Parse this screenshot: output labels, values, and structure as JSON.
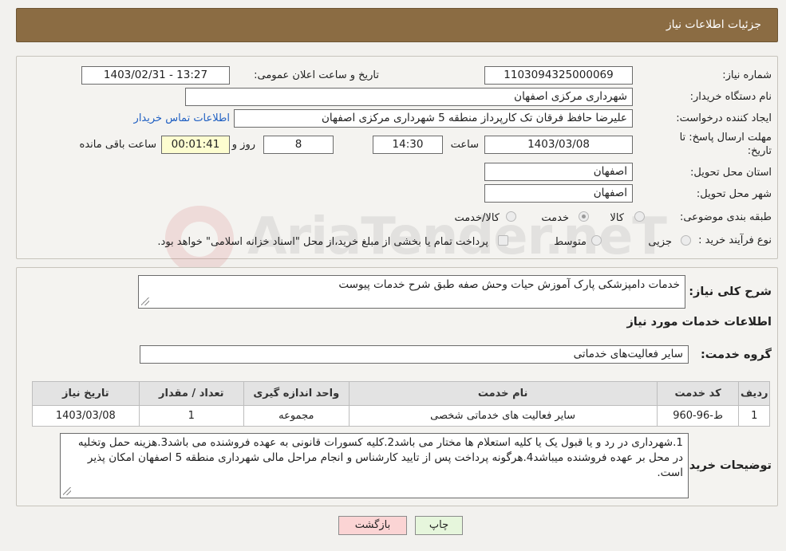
{
  "header": {
    "title": "جزئیات اطلاعات نیاز"
  },
  "details": {
    "need_number_label": "شماره نیاز:",
    "need_number": "1103094325000069",
    "announce_label": "تاریخ و ساعت اعلان عمومی:",
    "announce_value": "1403/02/31 - 13:27",
    "buyer_org_label": "نام دستگاه خریدار:",
    "buyer_org": "شهرداری مرکزی اصفهان",
    "creator_label": "ایجاد کننده درخواست:",
    "creator": "علیرضا حافظ فرقان تک کارپرداز منطقه 5 شهرداری مرکزی اصفهان",
    "contact_link": "اطلاعات تماس خریدار",
    "deadline_label_1": "مهلت ارسال پاسخ: تا",
    "deadline_label_2": "تاریخ:",
    "deadline_date": "1403/03/08",
    "time_label": "ساعت",
    "deadline_time": "14:30",
    "days_value": "8",
    "days_label": "روز و",
    "remaining_value": "00:01:41",
    "remaining_label": "ساعت باقی مانده",
    "province_label": "استان محل تحویل:",
    "province": "اصفهان",
    "city_label": "شهر محل تحویل:",
    "city": "اصفهان",
    "category_label": "طبقه بندی موضوعی:",
    "category_options": [
      "کالا",
      "خدمت",
      "کالا/خدمت"
    ],
    "category_selected": "خدمت",
    "process_label": "نوع فرآیند خرید :",
    "process_options": [
      "جزیی",
      "متوسط"
    ],
    "payment_note": "پرداخت تمام یا بخشی از مبلغ خرید،از محل \"اسناد خزانه اسلامی\" خواهد بود."
  },
  "summary": {
    "label": "شرح کلی نیاز:",
    "text": "خدمات دامپزشکی پارک آموزش حیات وحش صفه طبق شرح خدمات پیوست"
  },
  "services": {
    "section_title": "اطلاعات خدمات مورد نیاز",
    "group_label": "گروه خدمت:",
    "group_value": "سایر فعالیت‌های خدماتی",
    "columns": [
      "ردیف",
      "کد خدمت",
      "نام خدمت",
      "واحد اندازه گیری",
      "تعداد / مقدار",
      "تاریخ نیاز"
    ],
    "rows": [
      [
        "1",
        "ط-96-960",
        "سایر فعالیت های خدماتی شخصی",
        "مجموعه",
        "1",
        "1403/03/08"
      ]
    ]
  },
  "buyer_notes": {
    "label": "توضیحات خریدار:",
    "text": "1.شهرداری در رد و یا قبول یک یا کلیه استعلام ها مختار می باشد2.کلیه کسورات قانونی به عهده فروشنده می باشد3.هزینه حمل وتخلیه در محل بر عهده فروشنده میباشد4.هرگونه پرداخت پس از تایید کارشناس و انجام مراحل مالی شهرداری منطقه 5 اصفهان امکان پذیر است."
  },
  "buttons": {
    "print": "چاپ",
    "back": "بازگشت"
  },
  "watermark": {
    "text": "AriaTender.neT"
  },
  "colors": {
    "header": "#8b6c43",
    "link": "#1f5fc2",
    "remaining_bg": "#fdfdd0",
    "back_btn": "#fbd4d4",
    "print_btn": "#e6f6dc"
  }
}
